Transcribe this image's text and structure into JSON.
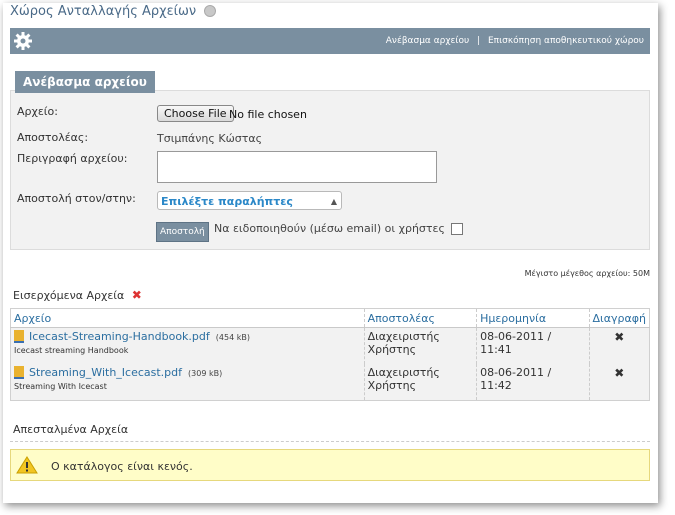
{
  "header": {
    "title": "Χώρος Ανταλλαγής Αρχείων"
  },
  "toolbar": {
    "link_upload": "Ανέβασμα αρχείου",
    "separator": "|",
    "link_overview": "Επισκόπηση αποθηκευτικού χώρου"
  },
  "upload": {
    "tab_label": "Ανέβασμα αρχείου",
    "file_label": "Αρχείο:",
    "choose_file": "Choose File",
    "no_file": "No file chosen",
    "sender_label": "Αποστολέας:",
    "sender_value": "Τσιμπάνης Κώστας",
    "description_label": "Περιγραφή αρχείου:",
    "send_to_label": "Αποστολή στον/στην:",
    "recipients_select": "Επιλέξτε παραλήπτες",
    "send_button": "Αποστολή",
    "notify_label": "Να ειδοποιηθούν (μέσω email) οι χρήστες"
  },
  "max_size": "Μέγιστο μέγεθος αρχείου: 50M",
  "incoming": {
    "title": "Εισερχόμενα Αρχεία",
    "columns": [
      "Αρχείο",
      "Αποστολέας",
      "Ημερομηνία",
      "Διαγραφή"
    ],
    "rows": [
      {
        "name": "Icecast-Streaming-Handbook.pdf",
        "size": "(454 kB)",
        "desc": "Icecast streaming Handbook",
        "sender": "Διαχειριστής Χρήστης",
        "date": "08-06-2011 / 11:41"
      },
      {
        "name": "Streaming_With_Icecast.pdf",
        "size": "(309 kB)",
        "desc": "Streaming With Icecast",
        "sender": "Διαχειριστής Χρήστης",
        "date": "08-06-2011 / 11:42"
      }
    ]
  },
  "sent": {
    "title": "Απεσταλμένα Αρχεία",
    "empty_message": "Ο κατάλογος είναι κενός."
  },
  "colors": {
    "toolbar": "#7a8fa0",
    "link": "#2b6ea0",
    "delete": "#dd3333",
    "warning_bg": "#fffdc8"
  }
}
